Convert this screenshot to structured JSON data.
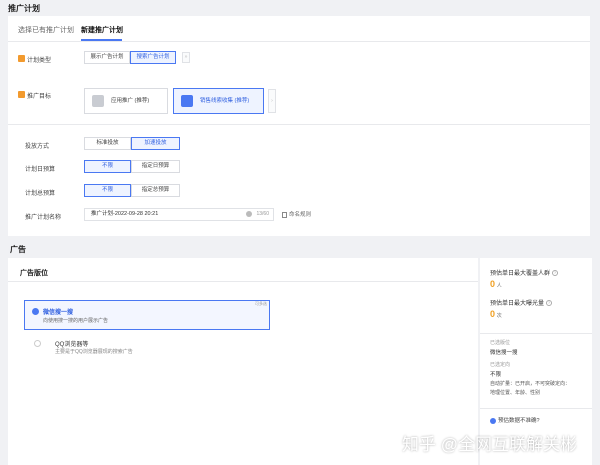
{
  "page_title": "推广计划",
  "tabs": [
    {
      "label": "选择已有推广计划"
    },
    {
      "label": "新建推广计划"
    }
  ],
  "plan_type": {
    "label": "计划类型",
    "options": [
      "展示广告计划",
      "搜索广告计划"
    ],
    "arrow": "»"
  },
  "goal": {
    "label": "推广目标",
    "options": [
      "应用推广 (推荐)",
      "销售线索收集 (推荐)"
    ],
    "arrow": "›"
  },
  "delivery": {
    "label": "投放方式",
    "options": [
      "标准投放",
      "加速投放"
    ]
  },
  "daily_budget": {
    "label": "计划日预算",
    "options": [
      "不限",
      "指定日预算"
    ]
  },
  "total_budget": {
    "label": "计划总预算",
    "options": [
      "不限",
      "指定总预算"
    ]
  },
  "plan_name": {
    "label": "推广计划名称",
    "value": "推广计划-2022-09-28 20:21",
    "counter": "13/60",
    "naming_rule": "命名规则"
  },
  "ad_section_title": "广告",
  "ad_slot": {
    "title": "广告版位",
    "recommend_badge": "可多选",
    "options": [
      {
        "name": "微信搜一搜",
        "desc": "向使用搜一搜的用户展示广告"
      },
      {
        "name": "QQ浏览器等",
        "desc": "主要是于QQ浏览器展现的搜索广告"
      }
    ]
  },
  "estimate": {
    "reach_label": "预估单日最大覆盖人群",
    "reach_value": "0",
    "reach_unit": "人",
    "exposure_label": "预估单日最大曝光量",
    "exposure_value": "0",
    "exposure_unit": "次",
    "slot_label": "已选版位",
    "slot_value": "微信搜一搜",
    "targeting_label": "已选定向",
    "targeting_value": "不限",
    "auto_expand": "自动扩量：已开启，不可突破定向：",
    "auto_expand_2": "地理位置、年龄、性别",
    "feedback": "预估数据不准确?"
  },
  "watermark": "知乎 @全网互联解关彬",
  "colors": {
    "accent": "#4a78f2",
    "orange": "#f0a023",
    "required": "#f29a2e",
    "bg": "#f0f1f4"
  }
}
